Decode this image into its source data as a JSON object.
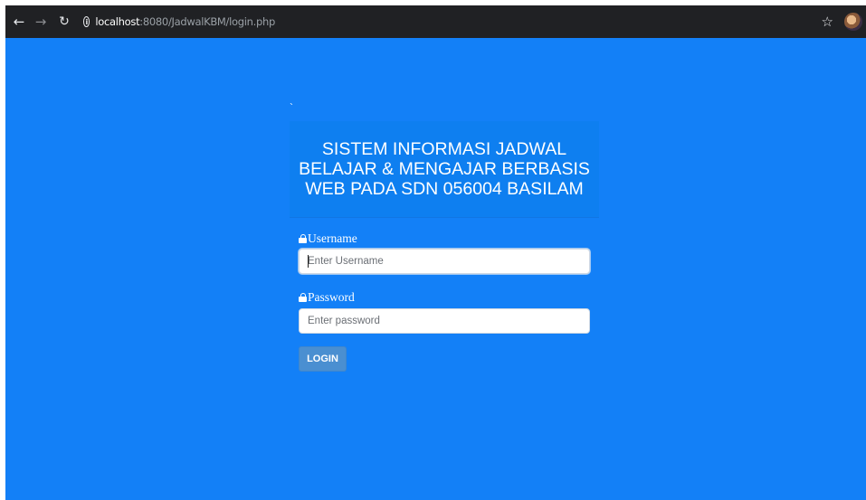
{
  "browser": {
    "url_host": "localhost",
    "url_rest": ":8080/JadwalKBM/login.php"
  },
  "page": {
    "tick_text": "`",
    "title": "SISTEM INFORMASI JADWAL BELAJAR & MENGAJAR BERBASIS WEB PADA SDN 056004 BASILAM"
  },
  "form": {
    "username_label": "Username",
    "username_placeholder": "Enter Username",
    "password_label": "Password",
    "password_placeholder": "Enter password",
    "login_label": "LOGIN"
  },
  "colors": {
    "page_background": "#1380f7",
    "title_panel": "#0e7ff0",
    "login_button": "#4a8fd1",
    "toolbar": "#202124"
  }
}
